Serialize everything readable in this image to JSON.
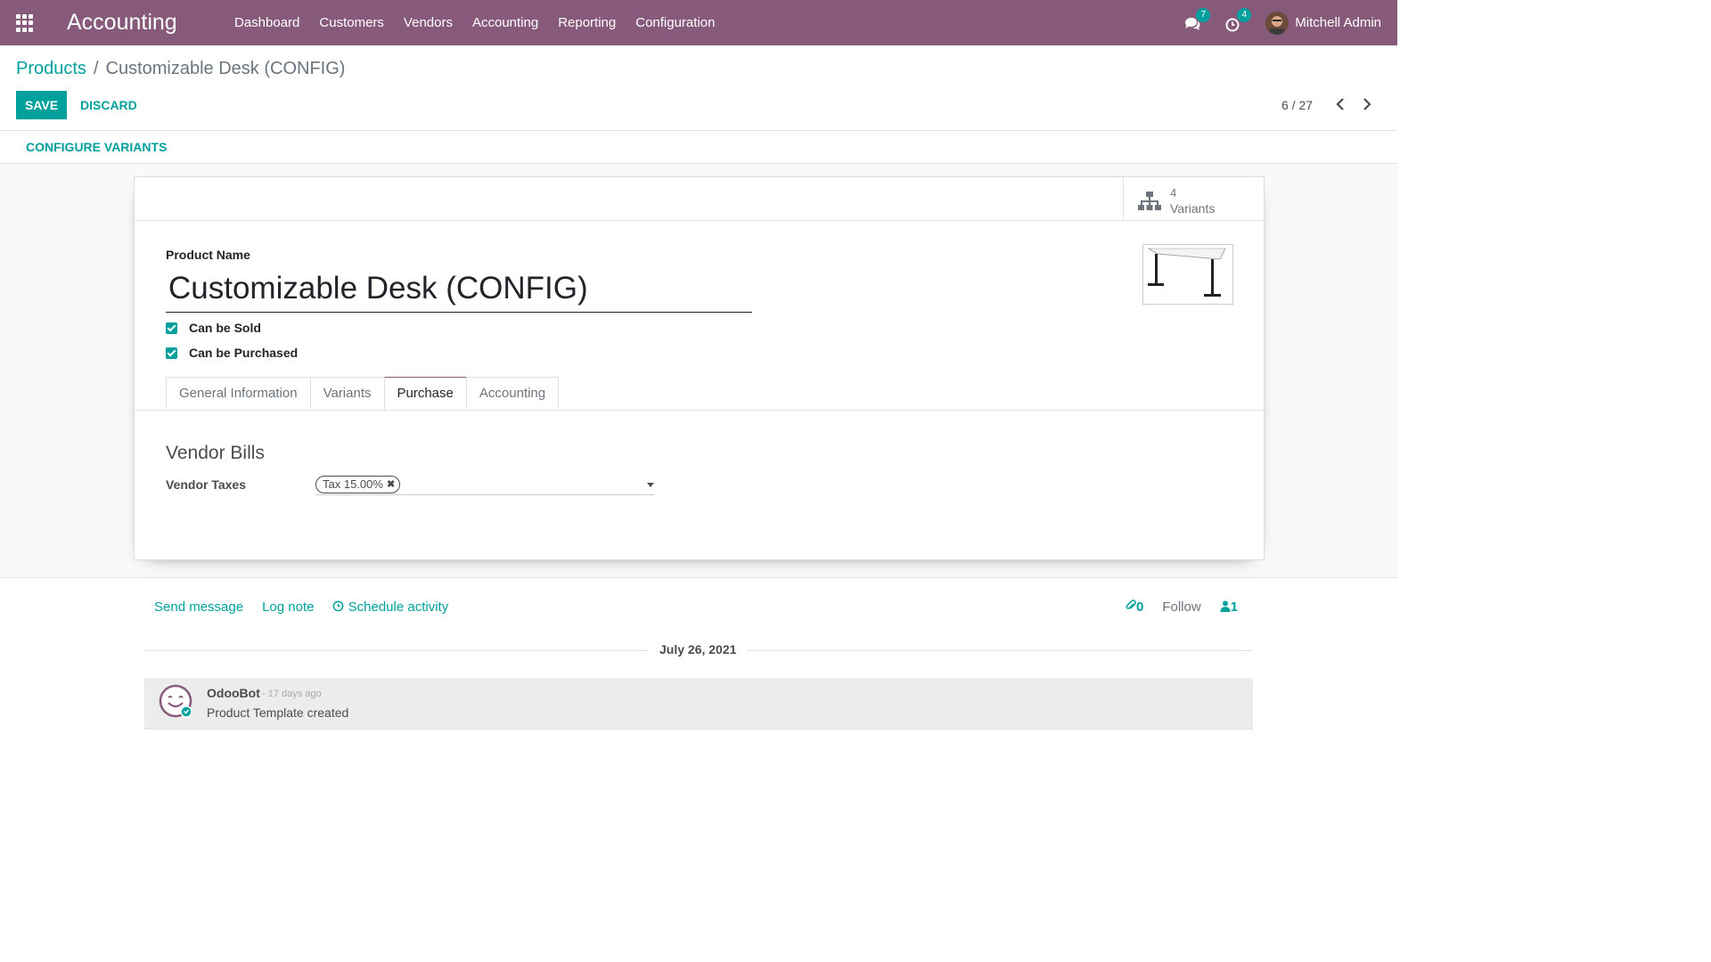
{
  "navbar": {
    "app_name": "Accounting",
    "menu": [
      "Dashboard",
      "Customers",
      "Vendors",
      "Accounting",
      "Reporting",
      "Configuration"
    ],
    "messages_count": "7",
    "activities_count": "4",
    "user_name": "Mitchell Admin",
    "bar_color": "#875a7b"
  },
  "control_panel": {
    "breadcrumb_parent": "Products",
    "breadcrumb_separator": "/",
    "breadcrumb_current": "Customizable Desk (CONFIG)",
    "save_label": "SAVE",
    "discard_label": "DISCARD",
    "pager": "6 / 27"
  },
  "statusbar": {
    "configure_variants_label": "CONFIGURE VARIANTS"
  },
  "form": {
    "variants_count": "4",
    "variants_label": "Variants",
    "product_name_label": "Product Name",
    "product_name": "Customizable Desk (CONFIG)",
    "can_be_sold_label": "Can be Sold",
    "can_be_purchased_label": "Can be Purchased",
    "tabs": [
      {
        "label": "General Information"
      },
      {
        "label": "Variants"
      },
      {
        "label": "Purchase"
      },
      {
        "label": "Accounting"
      }
    ],
    "active_tab": "Purchase",
    "section_title": "Vendor Bills",
    "vendor_taxes_label": "Vendor Taxes",
    "vendor_tax_tag": "Tax 15.00%",
    "accent_color": "#00a09d"
  },
  "chatter": {
    "send_message": "Send message",
    "log_note": "Log note",
    "schedule_activity": "Schedule activity",
    "attachments_count": "0",
    "follow_label": "Follow",
    "followers_count": "1",
    "date_separator": "July 26, 2021",
    "message": {
      "author": "OdooBot",
      "date": "- 17 days ago",
      "body": "Product Template created"
    }
  }
}
